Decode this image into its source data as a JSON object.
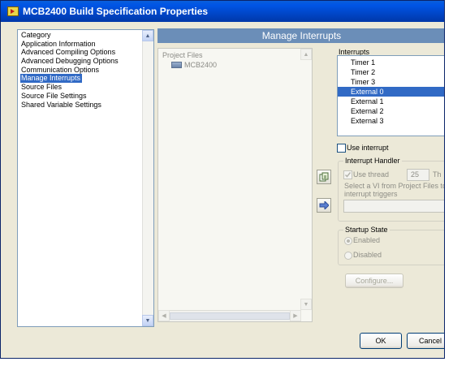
{
  "window": {
    "title": "MCB2400 Build Specification Properties"
  },
  "category": {
    "header": "Category",
    "items": [
      {
        "label": "Application Information",
        "selected": false
      },
      {
        "label": "Advanced Compiling Options",
        "selected": false
      },
      {
        "label": "Advanced Debugging Options",
        "selected": false
      },
      {
        "label": "Communication Options",
        "selected": false
      },
      {
        "label": "Manage Interrupts",
        "selected": true
      },
      {
        "label": "Source Files",
        "selected": false
      },
      {
        "label": "Source File Settings",
        "selected": false
      },
      {
        "label": "Shared Variable Settings",
        "selected": false
      }
    ]
  },
  "panel": {
    "title": "Manage Interrupts"
  },
  "project_files": {
    "label": "Project Files",
    "item": "MCB2400"
  },
  "interrupts": {
    "label": "Interrupts",
    "items": [
      "Timer 1",
      "Timer 2",
      "Timer 3",
      "External 0",
      "External 1",
      "External 2",
      "External 3"
    ],
    "selected": "External 0"
  },
  "use_interrupt": {
    "label": "Use interrupt",
    "checked": false
  },
  "handler": {
    "title": "Interrupt Handler",
    "use_thread_label": "Use thread",
    "use_thread_checked": true,
    "thread_value": "25",
    "thread_suffix": "Th",
    "vi_hint_line1": "Select a VI from Project Files to c",
    "vi_hint_line2": "interrupt triggers",
    "vi_path": ""
  },
  "startup": {
    "title": "Startup State",
    "enabled_label": "Enabled",
    "disabled_label": "Disabled",
    "selected": "Enabled"
  },
  "buttons": {
    "configure": "Configure...",
    "ok": "OK",
    "cancel": "Cancel"
  },
  "colors": {
    "title_bar": "#0055e5",
    "panel_header": "#6b8eb8",
    "selection": "#316ac5",
    "dialog_bg": "#ece9d8"
  }
}
